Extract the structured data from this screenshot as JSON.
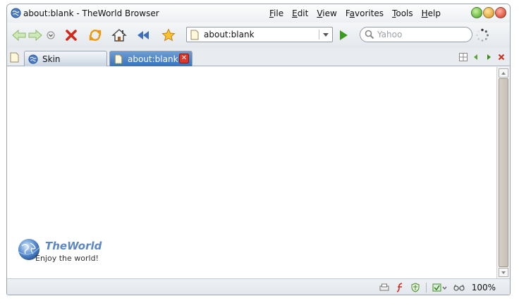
{
  "window": {
    "title": "about:blank - TheWorld Browser"
  },
  "menu": {
    "items": [
      {
        "label": "File",
        "accel": "F",
        "rest": "ile"
      },
      {
        "label": "Edit",
        "accel": "E",
        "rest": "dit"
      },
      {
        "label": "View",
        "accel": "V",
        "rest": "iew"
      },
      {
        "label": "Favorites",
        "accel": "",
        "pre": "F",
        "ul": "a",
        "post": "vorites"
      },
      {
        "label": "Tools",
        "accel": "T",
        "rest": "ools"
      },
      {
        "label": "Help",
        "accel": "H",
        "rest": "elp"
      }
    ]
  },
  "toolbar": {
    "icons": [
      "back-arrow-icon",
      "forward-arrow-icon",
      "dropdown-icon",
      "stop-icon",
      "refresh-icon",
      "home-icon",
      "rewind-icon",
      "favorites-star-icon"
    ],
    "address_value": "about:blank",
    "search_placeholder": "Yahoo"
  },
  "tabs": [
    {
      "label": "Skin",
      "active": false
    },
    {
      "label": "about:blank",
      "active": true
    }
  ],
  "brand": {
    "name": "TheWorld",
    "tagline": "Enjoy the world!"
  },
  "status": {
    "zoom": "100%"
  },
  "colors": {
    "accent_blue": "#3b73b8",
    "go_green": "#3c9a22",
    "close_red": "#d9382a",
    "brand_blue": "#5d86c4"
  }
}
